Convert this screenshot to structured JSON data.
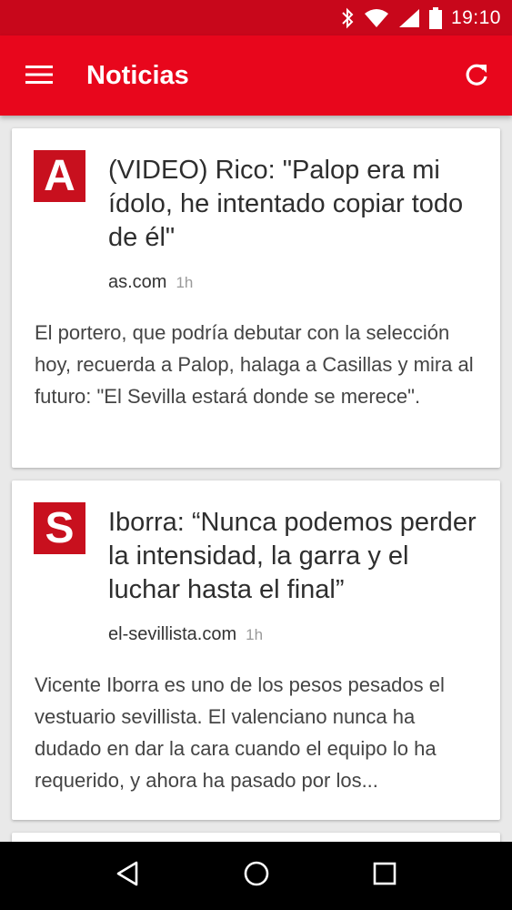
{
  "status_bar": {
    "time": "19:10",
    "icons": [
      "bluetooth-icon",
      "wifi-icon",
      "signal-icon",
      "battery-icon"
    ]
  },
  "app_bar": {
    "title": "Noticias",
    "menu_icon": "menu-icon",
    "refresh_icon": "refresh-icon"
  },
  "articles": [
    {
      "logo_letter": "A",
      "logo_color": "#c8101e",
      "headline": "(VIDEO) Rico: \"Palop era mi ídolo, he intentado copiar todo de él\"",
      "source": "as.com",
      "age": "1h",
      "summary": "El portero, que podría debutar con la selección hoy, recuerda a Palop, halaga a Casillas y mira al futuro: \"El Sevilla estará donde se merece\"."
    },
    {
      "logo_letter": "S",
      "logo_color": "#c8101e",
      "headline": "Iborra: “Nunca podemos perder la intensidad, la garra y el luchar hasta el final”",
      "source": "el-sevillista.com",
      "age": "1h",
      "summary": "Vicente Iborra es uno de los pesos pesados el vestuario sevillista. El valenciano nunca ha dudado en dar la cara cuando el equipo lo ha requerido, y ahora ha pasado por los..."
    }
  ],
  "colors": {
    "status_bar": "#c8071b",
    "app_bar": "#e8061c",
    "background": "#e9e9e9"
  },
  "nav_bar": {
    "icons": [
      "back-icon",
      "home-icon",
      "recents-icon"
    ]
  }
}
